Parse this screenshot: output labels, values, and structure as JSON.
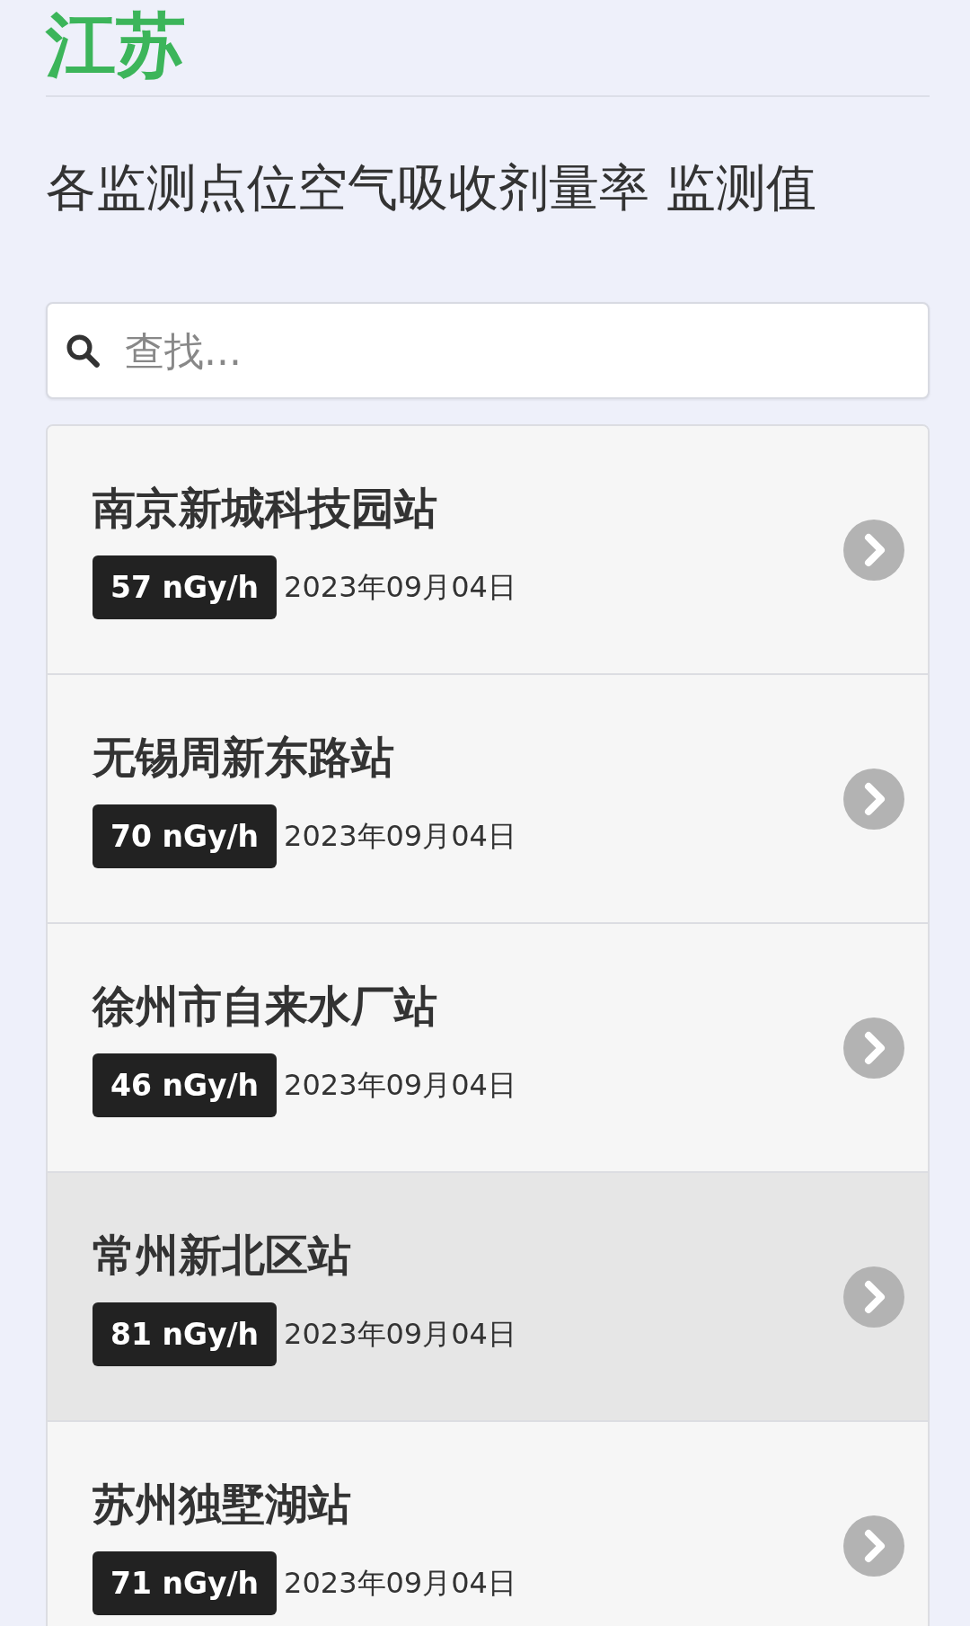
{
  "region": {
    "title": "江苏"
  },
  "heading": "各监测点位空气吸收剂量率 监测值",
  "search": {
    "placeholder": "查找..."
  },
  "stations": [
    {
      "name": "南京新城科技园站",
      "reading": "57 nGy/h",
      "date": "2023年09月04日",
      "selected": false
    },
    {
      "name": "无锡周新东路站",
      "reading": "70 nGy/h",
      "date": "2023年09月04日",
      "selected": false
    },
    {
      "name": "徐州市自来水厂站",
      "reading": "46 nGy/h",
      "date": "2023年09月04日",
      "selected": false
    },
    {
      "name": "常州新北区站",
      "reading": "81 nGy/h",
      "date": "2023年09月04日",
      "selected": true
    },
    {
      "name": "苏州独墅湖站",
      "reading": "71 nGy/h",
      "date": "2023年09月04日",
      "selected": false
    }
  ]
}
